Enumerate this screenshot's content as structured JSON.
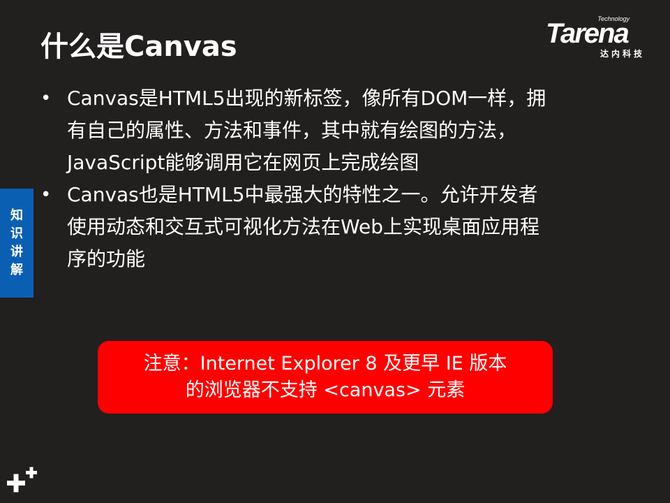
{
  "slide": {
    "title": "什么是Canvas"
  },
  "logo": {
    "small_text": "Technology",
    "brand": "Tarena",
    "subtitle": "达内科技"
  },
  "side_tab": {
    "chars": [
      "知",
      "识",
      "讲",
      "解"
    ],
    "color": "#0b5fb3"
  },
  "bullets": [
    {
      "marker": "•",
      "lines": [
        "Canvas是HTML5出现的新标签，像所有DOM一样，拥",
        "有自己的属性、方法和事件，其中就有绘图的方法，",
        "JavaScript能够调用它在网页上完成绘图"
      ]
    },
    {
      "marker": "•",
      "lines": [
        "Canvas也是HTML5中最强大的特性之一。允许开发者",
        "使用动态和交互式可视化方法在Web上实现桌面应用程",
        "序的功能"
      ]
    }
  ],
  "note": {
    "lines": [
      "注意：Internet Explorer 8 及更早 IE 版本",
      "的浏览器不支持 <canvas> 元素"
    ],
    "color": "#ff0000"
  },
  "decor": {
    "icon": "plus-icon"
  }
}
